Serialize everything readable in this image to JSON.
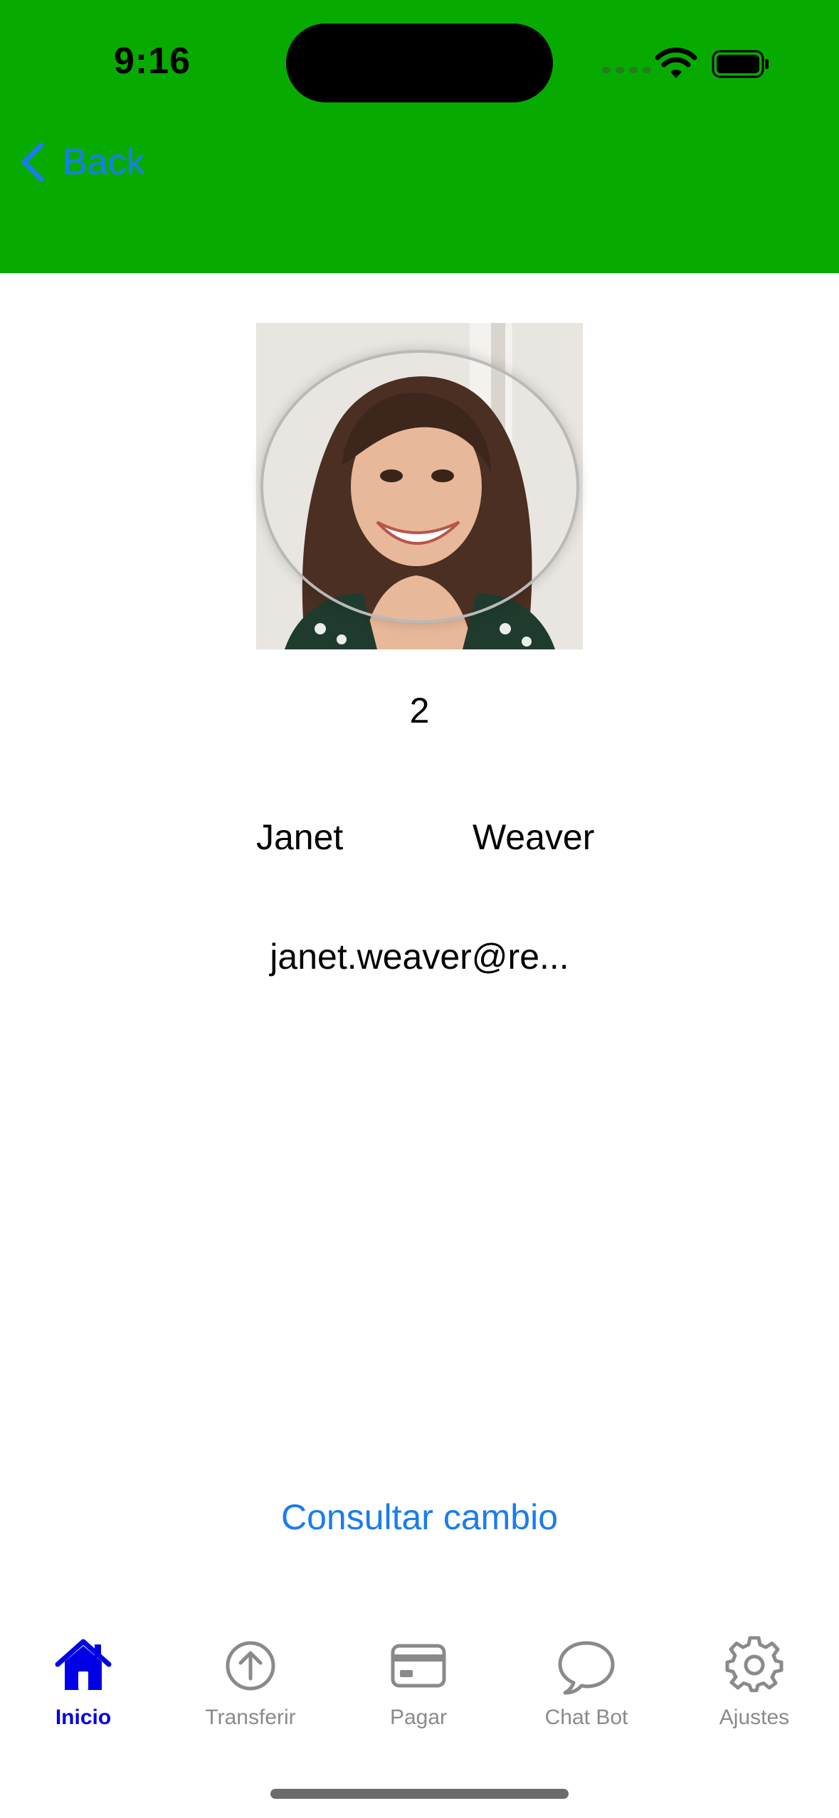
{
  "status_bar": {
    "time": "9:16"
  },
  "nav": {
    "back_label": "Back"
  },
  "profile": {
    "id": "2",
    "first_name": "Janet",
    "last_name": "Weaver",
    "email": "janet.weaver@re..."
  },
  "actions": {
    "exchange_label": "Consultar cambio"
  },
  "tabbar": {
    "items": [
      {
        "label": "Inicio",
        "icon": "house-icon",
        "active": true
      },
      {
        "label": "Transferir",
        "icon": "arrow-up-circle-icon",
        "active": false
      },
      {
        "label": "Pagar",
        "icon": "credit-card-icon",
        "active": false
      },
      {
        "label": "Chat Bot",
        "icon": "chat-bubble-icon",
        "active": false
      },
      {
        "label": "Ajustes",
        "icon": "gear-icon",
        "active": false
      }
    ]
  },
  "colors": {
    "header": "#07ab00",
    "link": "#1a7cf0",
    "tab_active": "#0000e6",
    "tab_inactive": "#8a8a8a"
  }
}
